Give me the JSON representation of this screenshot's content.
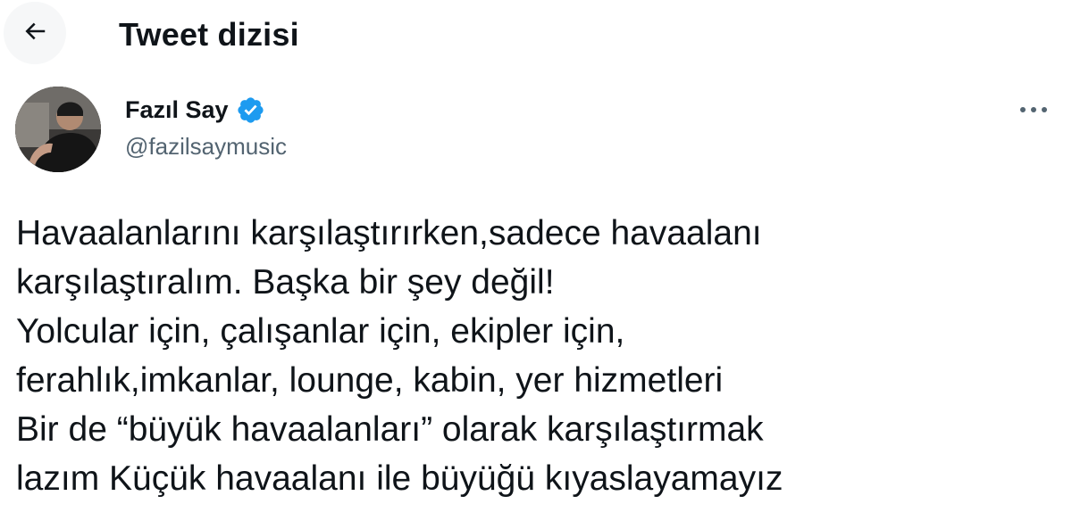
{
  "header": {
    "title": "Tweet dizisi",
    "back_icon": "arrow-left-icon"
  },
  "author": {
    "display_name": "Fazıl Say",
    "handle": "@fazilsaymusic",
    "verified_icon": "verified-badge-icon",
    "verified_color": "#1d9bf0",
    "avatar_icon": "profile-photo",
    "more_icon": "more-horizontal-icon"
  },
  "tweet": {
    "lines": [
      "Havaalanlarını karşılaştırırken,sadece havaalanı",
      "karşılaştıralım. Başka bir şey değil!",
      "Yolcular için, çalışanlar için, ekipler için,",
      "ferahlık,imkanlar, lounge, kabin, yer hizmetleri",
      "Bir de “büyük havaalanları” olarak karşılaştırmak",
      "lazım Küçük havaalanı ile büyüğü kıyaslayamayız"
    ]
  },
  "colors": {
    "text": "#0f1419",
    "secondary_text": "#536471",
    "background": "#ffffff",
    "accent": "#1d9bf0"
  }
}
